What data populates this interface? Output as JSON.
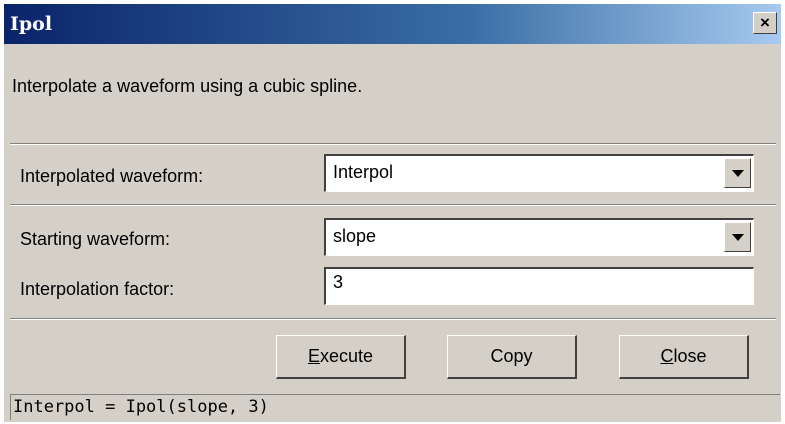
{
  "window": {
    "title": "Ipol",
    "close_glyph": "×"
  },
  "description": "Interpolate a waveform using a cubic spline.",
  "fields": {
    "interpolated_waveform": {
      "label": "Interpolated waveform:",
      "value": "Interpol"
    },
    "starting_waveform": {
      "label": "Starting waveform:",
      "value": "slope"
    },
    "interpolation_factor": {
      "label": "Interpolation factor:",
      "value": "3"
    }
  },
  "buttons": {
    "execute": {
      "label": "Execute",
      "mnemonic": "E",
      "rest": "xecute"
    },
    "copy": {
      "label": "Copy"
    },
    "close": {
      "label": "Close",
      "mnemonic": "C",
      "rest": "lose"
    }
  },
  "command_line": "Interpol = Ipol(slope, 3)",
  "colors": {
    "titlebar_start": "#0a246a",
    "titlebar_end": "#a6caf0",
    "dialog_bg": "#d4d0c8"
  },
  "icons": {
    "dropdown": "chevron-down-icon",
    "close": "close-icon"
  }
}
